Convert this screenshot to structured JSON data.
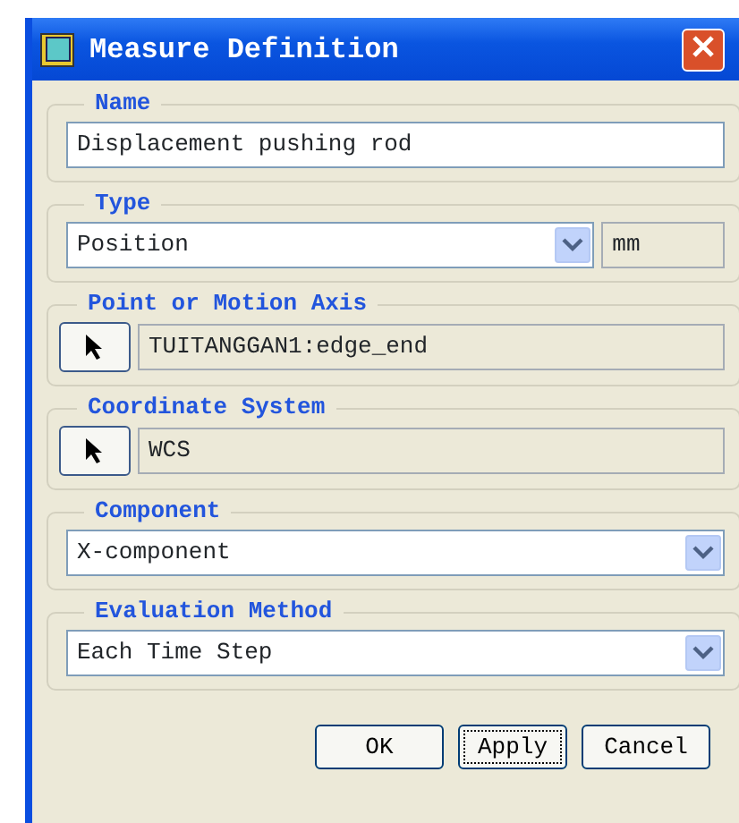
{
  "window": {
    "title": "Measure Definition"
  },
  "sections": [
    {
      "kind": "text",
      "label": "Name",
      "value": "Displacement pushing rod"
    },
    {
      "kind": "dropdown_unit",
      "label": "Type",
      "value": "Position",
      "unit": "mm"
    },
    {
      "kind": "picker",
      "label": "Point or Motion Axis",
      "value": "TUITANGGAN1:edge_end"
    },
    {
      "kind": "picker",
      "label": "Coordinate System",
      "value": "WCS"
    },
    {
      "kind": "dropdown",
      "label": "Component",
      "value": "X-component"
    },
    {
      "kind": "dropdown",
      "label": "Evaluation Method",
      "value": "Each Time Step"
    }
  ],
  "buttons": [
    {
      "label": "OK",
      "focused": false
    },
    {
      "label": "Apply",
      "focused": true
    },
    {
      "label": "Cancel",
      "focused": false
    }
  ]
}
